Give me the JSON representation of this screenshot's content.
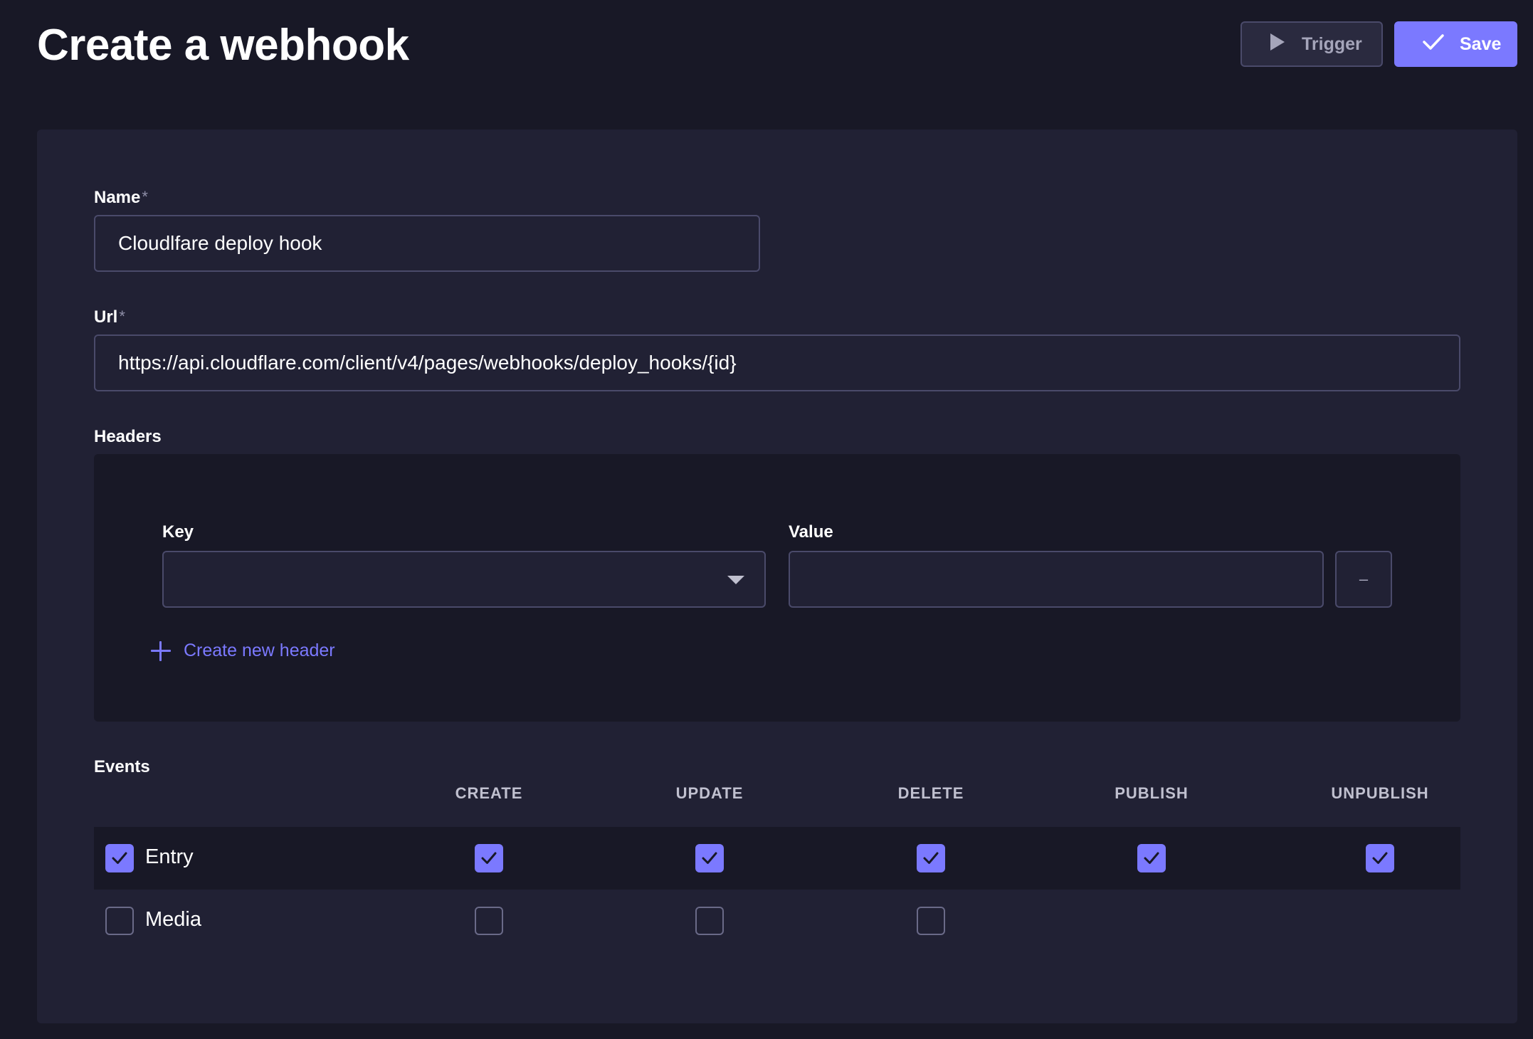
{
  "page": {
    "title": "Create a webhook"
  },
  "header_actions": {
    "trigger_label": "Trigger",
    "save_label": "Save"
  },
  "form": {
    "name": {
      "label": "Name",
      "required_mark": "*",
      "value": "Cloudlfare deploy hook"
    },
    "url": {
      "label": "Url",
      "required_mark": "*",
      "value": "https://api.cloudflare.com/client/v4/pages/webhooks/deploy_hooks/{id}"
    },
    "headers": {
      "label": "Headers",
      "key_label": "Key",
      "key_value": "",
      "value_label": "Value",
      "value_value": "",
      "remove_label": "–",
      "create_label": "Create new header"
    },
    "events": {
      "label": "Events",
      "columns": [
        "CREATE",
        "UPDATE",
        "DELETE",
        "PUBLISH",
        "UNPUBLISH"
      ],
      "rows": [
        {
          "label": "Entry",
          "checked": true,
          "cells": [
            true,
            true,
            true,
            true,
            true
          ]
        },
        {
          "label": "Media",
          "checked": false,
          "cells": [
            false,
            false,
            false
          ]
        }
      ]
    }
  },
  "colors": {
    "background": "#181826",
    "card": "#212134",
    "accent": "#7b79ff",
    "border": "#4a4a6a"
  },
  "icons": {
    "trigger": "play-icon",
    "save": "check-icon",
    "select": "caret-down-icon",
    "add": "plus-icon",
    "checkbox": "check-icon"
  }
}
